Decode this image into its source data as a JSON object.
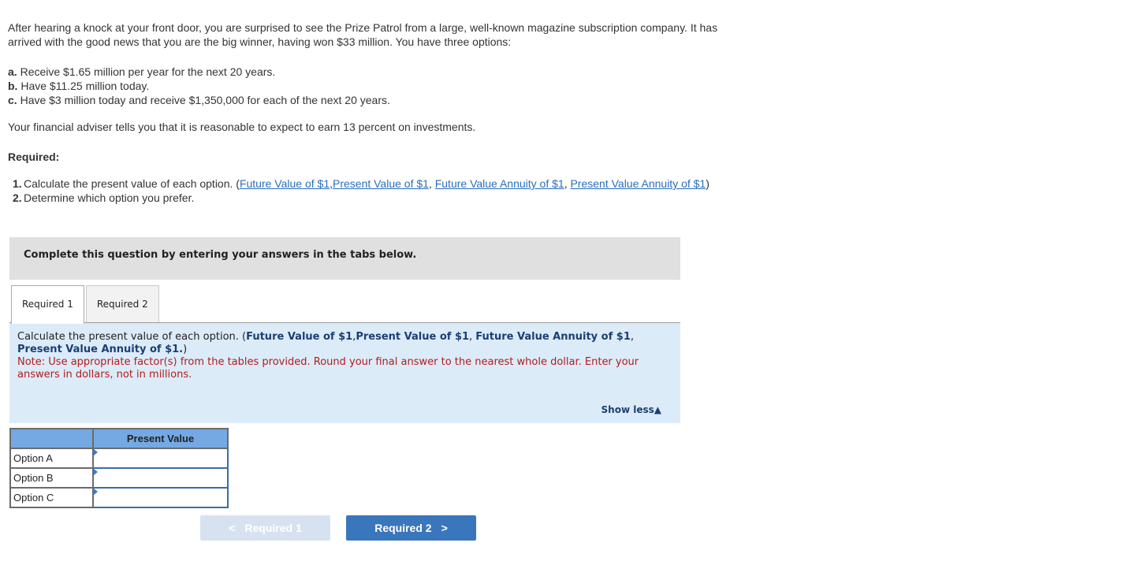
{
  "problem": {
    "intro": "After hearing a knock at your front door, you are surprised to see the Prize Patrol from a large, well-known magazine subscription company. It has arrived with the good news that you are the big winner, having won $33 million. You have three options:",
    "options": [
      {
        "letter": "a.",
        "text": "Receive $1.65 million per year for the next 20 years."
      },
      {
        "letter": "b.",
        "text": "Have $11.25 million today."
      },
      {
        "letter": "c.",
        "text": "Have $3 million today and receive $1,350,000 for each of the next 20 years."
      }
    ],
    "adviser": "Your financial adviser tells you that it is reasonable to expect to earn 13 percent on investments.",
    "required_heading": "Required:",
    "required_items": [
      {
        "num": "1.",
        "text": "Calculate the present value of each option. (",
        "links": [
          "Future Value of $1",
          "Present Value of $1",
          "Future Value Annuity of $1",
          "Present Value Annuity of $1"
        ],
        "suffix": ")"
      },
      {
        "num": "2.",
        "text": "Determine which option you prefer."
      }
    ]
  },
  "instruction_bar": "Complete this question by entering your answers in the tabs below.",
  "tabs": [
    {
      "label": "Required 1",
      "active": true
    },
    {
      "label": "Required 2",
      "active": false
    }
  ],
  "prompt": {
    "lead": "Calculate the present value of each option. (",
    "links": [
      "Future Value of $1",
      "Present Value of $1",
      "Future Value Annuity of $1",
      "Present Value Annuity of $1."
    ],
    "suffix": ")",
    "note": "Note: Use appropriate factor(s) from the tables provided. Round your final answer to the nearest whole dollar. Enter your answers in dollars, not in millions.",
    "show_less": "Show less",
    "show_less_icon": "triangle-up-icon"
  },
  "answer_table": {
    "column_header": "Present Value",
    "rows": [
      {
        "label": "Option A",
        "value": ""
      },
      {
        "label": "Option B",
        "value": ""
      },
      {
        "label": "Option C",
        "value": ""
      }
    ],
    "accent_color": "#74a9e3"
  },
  "navigation": {
    "prev_label": "Required 1",
    "prev_icon": "chevron-left-icon",
    "prev_enabled": false,
    "next_label": "Required 2",
    "next_icon": "chevron-right-icon",
    "next_color": "#3a76bc"
  }
}
